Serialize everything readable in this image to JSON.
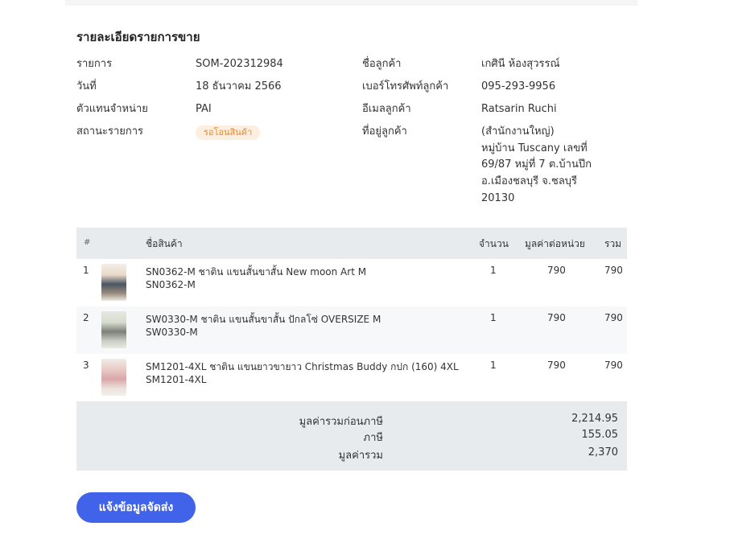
{
  "title": "รายละเอียดรายการขาย",
  "order": {
    "id_label": "รายการ",
    "id_value": "SOM-202312984",
    "date_label": "วันที่",
    "date_value": "18 ธันวาคม 2566",
    "agent_label": "ตัวแทนจำหน่าย",
    "agent_value": "PAI",
    "status_label": "สถานะรายการ",
    "status_value": "รอโอนสินค้า",
    "status_color": "#e08a3c"
  },
  "customer": {
    "name_label": "ชื่อลูกค้า",
    "name_value": "เกศินี ห้องสุวรรณ์",
    "phone_label": "เบอร์โทรศัพท์ลูกค้า",
    "phone_value": "095-293-9956",
    "email_label": "อีเมลลูกค้า",
    "email_value": "Ratsarin Ruchi",
    "address_label": "ที่อยู่ลูกค้า",
    "address_lines": [
      "(สำนักงานใหญ่)",
      "หมู่บ้าน Tuscany เลขที่",
      "69/87 หมู่ที่ 7 ต.บ้านปึก",
      "อ.เมืองชลบุรี จ.ชลบุรี",
      "20130"
    ]
  },
  "table": {
    "headers": {
      "index": "#",
      "name": "ชื่อสินค้า",
      "qty": "จำนวน",
      "unit_price": "มูลค่าต่อหน่วย",
      "total": "รวม"
    },
    "rows": [
      {
        "index": "1",
        "name": "SN0362-M ชาติน แขนสั้นขาสั้น New moon Art M",
        "sku": "SN0362-M",
        "qty": "1",
        "unit_price": "790",
        "total": "790",
        "image": "product-thumbnail"
      },
      {
        "index": "2",
        "name": "SW0330-M ชาติน แขนสั้นขาสั้น ปักลโซ่ OVERSIZE M",
        "sku": "SW0330-M",
        "qty": "1",
        "unit_price": "790",
        "total": "790",
        "image": "product-thumbnail"
      },
      {
        "index": "3",
        "name": "SM1201-4XL ชาติน แขนยาวขายาว Christmas Buddy กปก (160) 4XL",
        "sku": "SM1201-4XL",
        "qty": "1",
        "unit_price": "790",
        "total": "790",
        "image": "product-thumbnail"
      }
    ]
  },
  "summary": {
    "subtotal_label": "มูลค่ารวมก่อนภาษี",
    "subtotal_value": "2,214.95",
    "tax_label": "ภาษี",
    "tax_value": "155.05",
    "grand_label": "มูลค่ารวม",
    "grand_value": "2,370"
  },
  "action": {
    "notify_label": "แจ้งข้อมูลจัดส่ง"
  },
  "colors": {
    "primary": "#4163e9",
    "header_bg": "#e8ebee"
  }
}
